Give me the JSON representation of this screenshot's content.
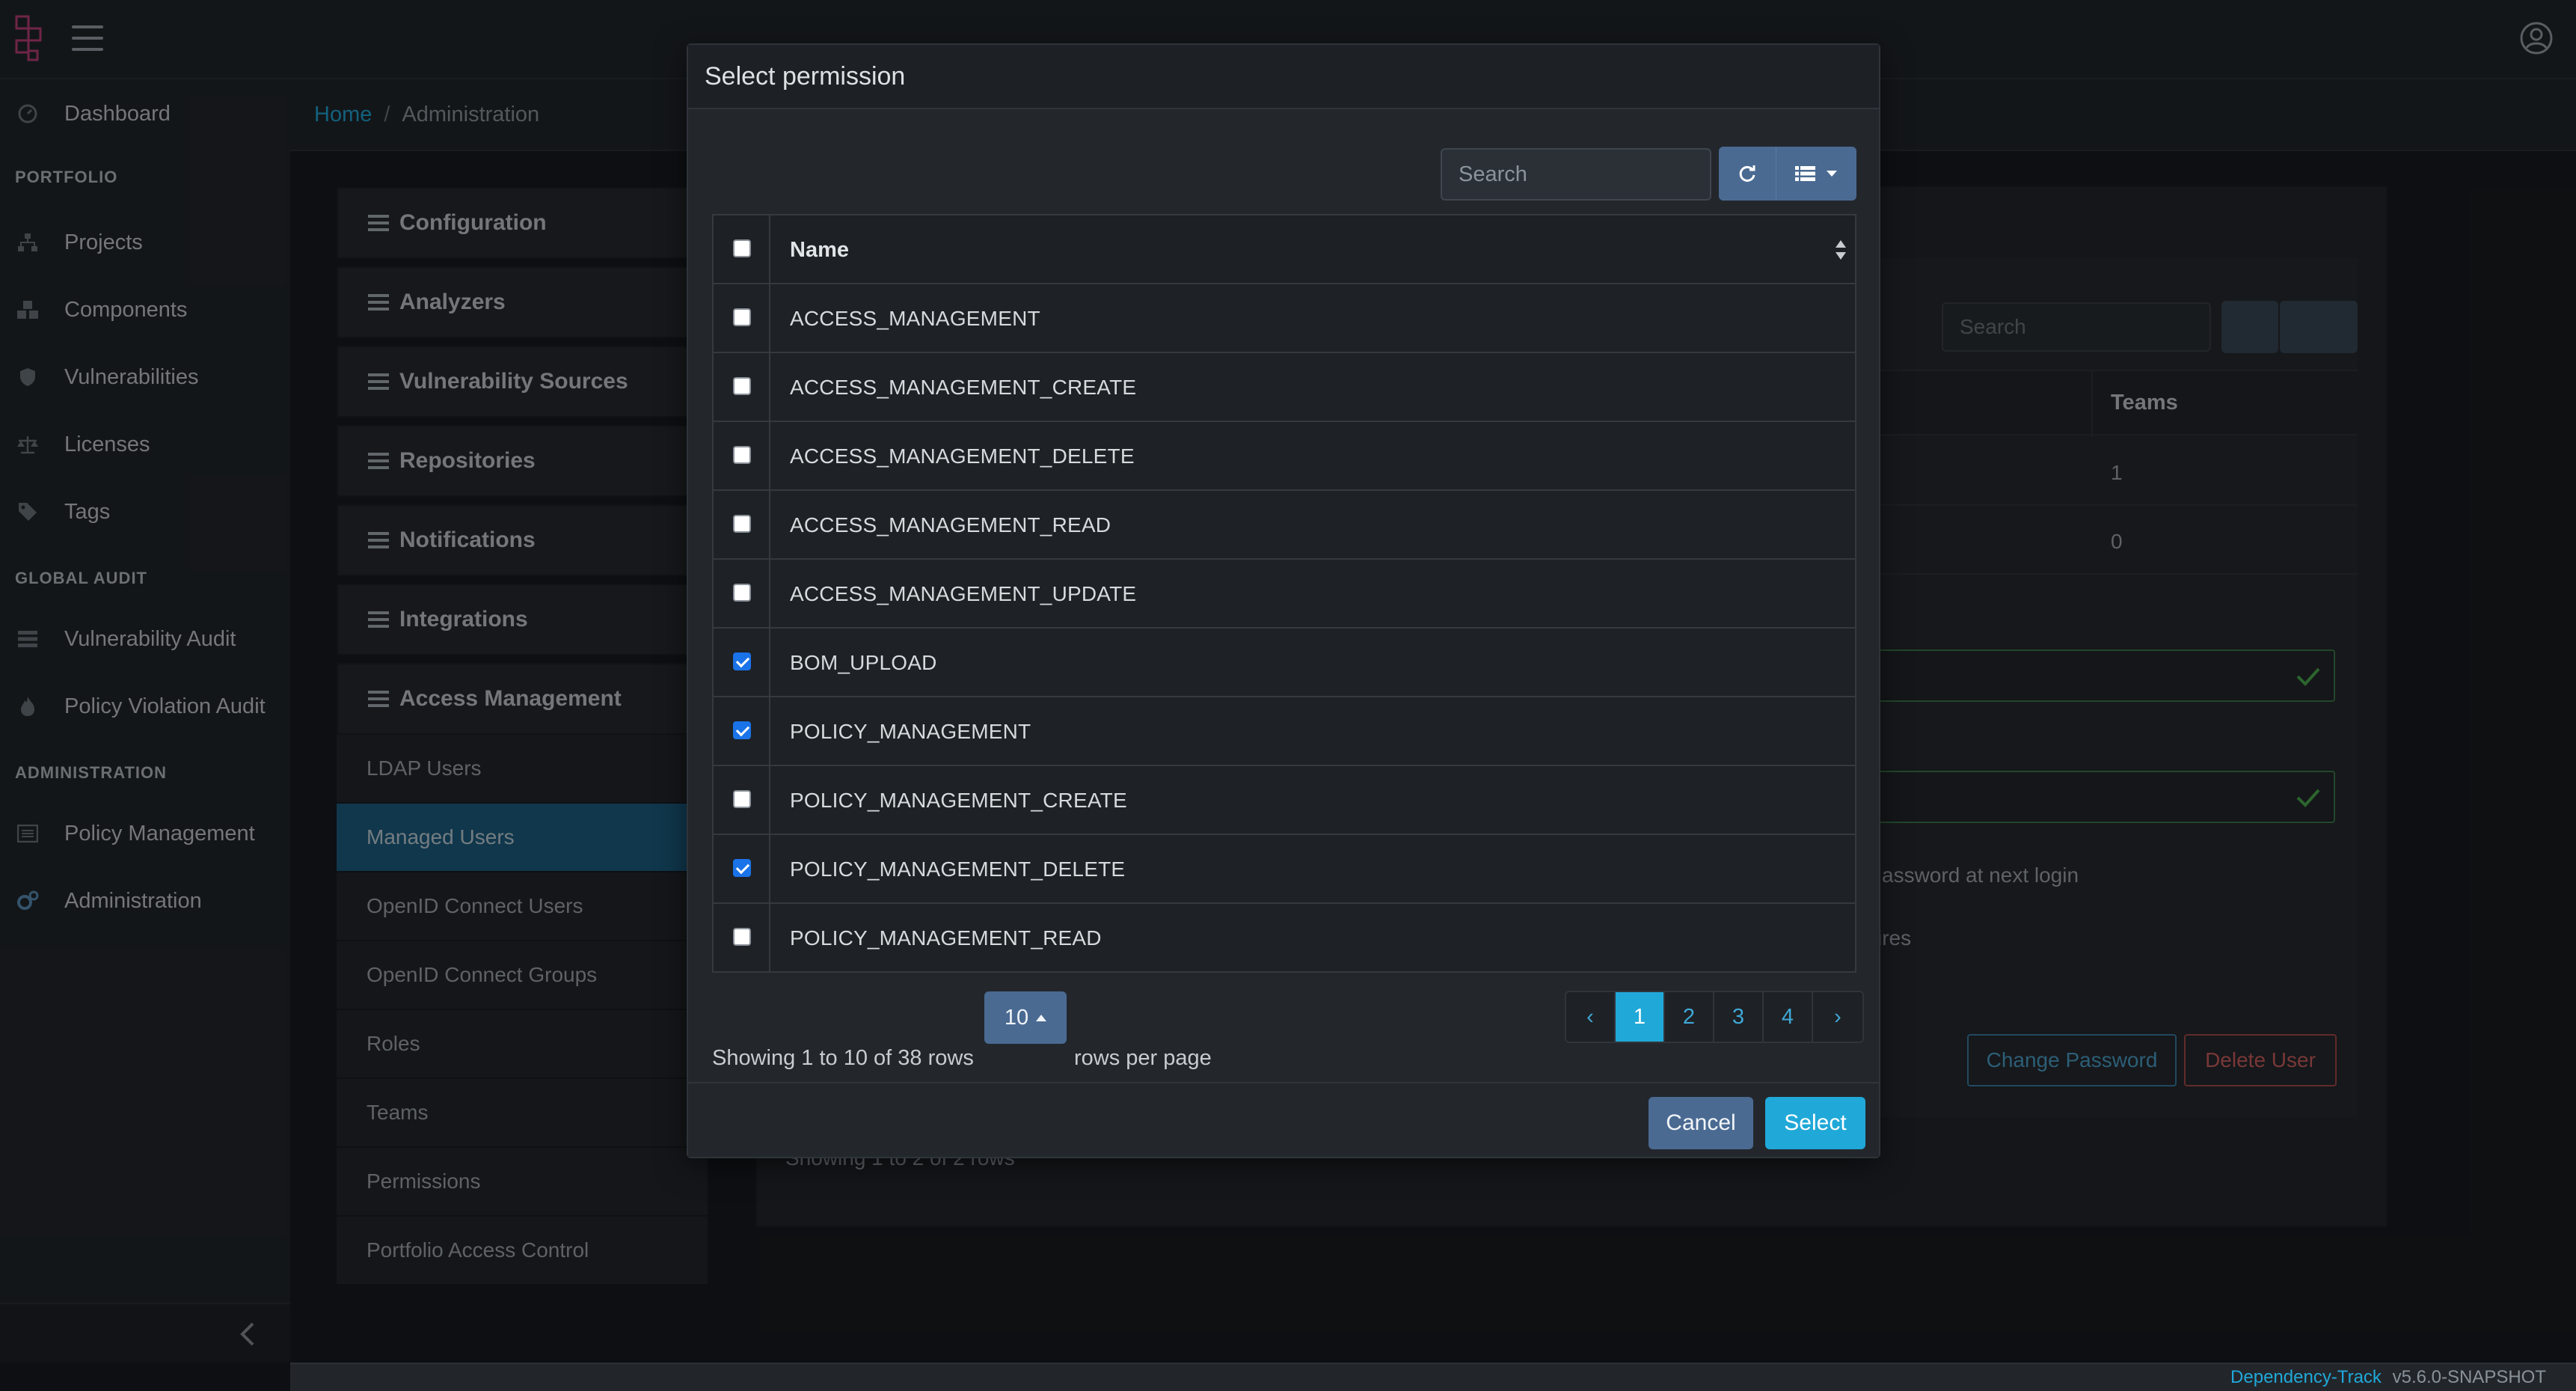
{
  "header": {
    "logo_icon": "dependency-track-logo",
    "menu_icon": "hamburger-icon",
    "profile_icon": "user-circle-icon"
  },
  "sidebar": {
    "items": [
      {
        "label": "Dashboard",
        "icon": "gauge-icon"
      },
      {
        "section": "PORTFOLIO"
      },
      {
        "label": "Projects",
        "icon": "sitemap-icon"
      },
      {
        "label": "Components",
        "icon": "cubes-icon"
      },
      {
        "label": "Vulnerabilities",
        "icon": "shield-icon"
      },
      {
        "label": "Licenses",
        "icon": "balance-scale-icon"
      },
      {
        "label": "Tags",
        "icon": "tag-icon"
      },
      {
        "section": "GLOBAL AUDIT"
      },
      {
        "label": "Vulnerability Audit",
        "icon": "tasks-icon"
      },
      {
        "label": "Policy Violation Audit",
        "icon": "fire-icon"
      },
      {
        "section": "ADMINISTRATION"
      },
      {
        "label": "Policy Management",
        "icon": "list-alt-icon"
      },
      {
        "label": "Administration",
        "icon": "cogs-icon"
      }
    ],
    "collapse_icon": "chevron-left-icon"
  },
  "breadcrumb": {
    "home": "Home",
    "separator": "/",
    "current": "Administration"
  },
  "admin_menu": {
    "sections": [
      "Configuration",
      "Analyzers",
      "Vulnerability Sources",
      "Repositories",
      "Notifications",
      "Integrations",
      "Access Management"
    ],
    "access_items": [
      "LDAP Users",
      "Managed Users",
      "OpenID Connect Users",
      "OpenID Connect Groups",
      "Roles",
      "Teams",
      "Permissions",
      "Portfolio Access Control"
    ],
    "active": "Managed Users"
  },
  "background": {
    "search_placeholder": "Search",
    "teams_header": "Teams",
    "team_counts": [
      "1",
      "0"
    ],
    "force_password_text": "assword at next login",
    "expires_text": "ires",
    "change_password": "Change Password",
    "delete_user": "Delete User",
    "showing": "Showing 1 to 2 of 2 rows"
  },
  "modal": {
    "title": "Select permission",
    "search_placeholder": "Search",
    "column_name": "Name",
    "permissions": [
      {
        "name": "ACCESS_MANAGEMENT",
        "checked": false
      },
      {
        "name": "ACCESS_MANAGEMENT_CREATE",
        "checked": false
      },
      {
        "name": "ACCESS_MANAGEMENT_DELETE",
        "checked": false
      },
      {
        "name": "ACCESS_MANAGEMENT_READ",
        "checked": false
      },
      {
        "name": "ACCESS_MANAGEMENT_UPDATE",
        "checked": false
      },
      {
        "name": "BOM_UPLOAD",
        "checked": true
      },
      {
        "name": "POLICY_MANAGEMENT",
        "checked": true
      },
      {
        "name": "POLICY_MANAGEMENT_CREATE",
        "checked": false
      },
      {
        "name": "POLICY_MANAGEMENT_DELETE",
        "checked": true
      },
      {
        "name": "POLICY_MANAGEMENT_READ",
        "checked": false
      }
    ],
    "paging": {
      "showing": "Showing 1 to 10 of 38 rows",
      "page_size": "10",
      "rows_per_page": "rows per page",
      "prev": "‹",
      "pages": [
        "1",
        "2",
        "3",
        "4"
      ],
      "next": "›",
      "active_page": "1"
    },
    "cancel": "Cancel",
    "select": "Select"
  },
  "footer": {
    "brand": "Dependency-Track",
    "version": "v5.6.0-SNAPSHOT"
  },
  "colors": {
    "accent": "#20a8d8",
    "button": "#4a6a92",
    "checkbox": "#1a73e8",
    "active_menu": "#1d5f83"
  }
}
